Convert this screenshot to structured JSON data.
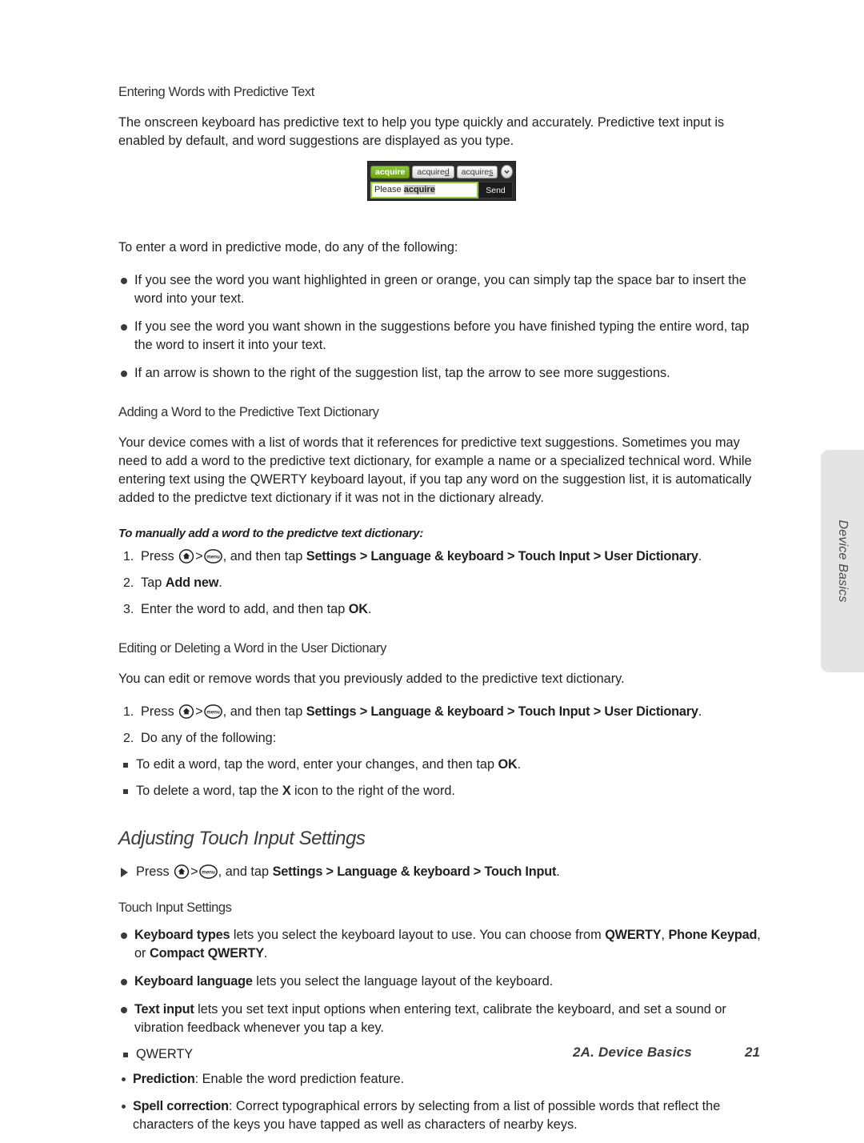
{
  "page": {
    "side_tab_label": "Device Basics",
    "footer_title": "2A. Device Basics",
    "footer_page": "21"
  },
  "colors": {
    "accent_green": "#8cc63f",
    "chip_active_green": "#6ca31a",
    "side_tab_gray": "#e4e4e4",
    "text": "#231f20"
  },
  "sections": {
    "predictive_text": {
      "heading": "Entering Words with Predictive Text",
      "intro": "The onscreen keyboard has predictive text to help you type quickly and accurately. Predictive text input is enabled by default, and word suggestions are displayed as you type.",
      "lead_in": "To enter a word in predictive mode, do any of the following:",
      "bullets": [
        "If you see the word you want highlighted in green or orange, you can simply tap the space bar to insert the word into your text.",
        "If you see the word you want shown in the suggestions before you have finished typing the entire word, tap the word to insert it into your text.",
        "If an arrow is shown to the right of the suggestion list, tap the arrow to see more suggestions."
      ]
    },
    "figure": {
      "suggestions": [
        {
          "text": "acquire",
          "active": true,
          "underline_last": false
        },
        {
          "text": "acquire",
          "suffix": "d",
          "active": false,
          "underline_last": true
        },
        {
          "text": "acquire",
          "suffix": "s",
          "active": false,
          "underline_last": true
        }
      ],
      "arrow_icon": "chevron-down-icon",
      "input_prefix": "Please ",
      "input_highlight": "acquire",
      "send_label": "Send"
    },
    "adding_word": {
      "heading": "Adding a Word to the Predictive Text Dictionary",
      "body": "Your device comes with a list of words that it references for predictive text suggestions. Sometimes you may need to add a word to the predictive text dictionary, for example a name or a specialized technical word. While entering text using the QWERTY keyboard layout, if you tap any word on the suggestion list, it is automatically added to the predictve text dictionary if it was not in the dictionary already.",
      "procedure_title": "To manually add a word to the predictve text dictionary:",
      "steps": [
        {
          "pre": "Press ",
          "keys": [
            "home-key",
            "menu-key"
          ],
          "mid": ", and then tap ",
          "path": [
            "Settings",
            "Language & keyboard",
            "Touch Input",
            "User Dictionary"
          ],
          "post": "."
        },
        {
          "pre": "Tap ",
          "bold": "Add new",
          "post": "."
        },
        {
          "pre": "Enter the word to add, and then tap ",
          "bold": "OK",
          "post": "."
        }
      ]
    },
    "editing_word": {
      "heading": "Editing or Deleting a Word in the User Dictionary",
      "body": "You can edit or remove words that you previously added to the predictive text dictionary.",
      "steps": [
        {
          "pre": "Press ",
          "keys": [
            "home-key",
            "menu-key"
          ],
          "mid": ", and then tap ",
          "path": [
            "Settings",
            "Language & keyboard",
            "Touch Input",
            "User Dictionary"
          ],
          "post": "."
        },
        {
          "pre": "Do any of the following:"
        }
      ],
      "sub_bullets": [
        {
          "pre": "To edit a word, tap the word, enter your changes, and then tap ",
          "bold": "OK",
          "post": "."
        },
        {
          "pre": "To delete a word, tap the ",
          "bold": "X",
          "post": " icon to the right of the word."
        }
      ]
    },
    "touch_input": {
      "heading": "Adjusting Touch Input Settings",
      "press_item": {
        "pre": "Press ",
        "keys": [
          "home-key",
          "menu-key"
        ],
        "mid": ", and tap ",
        "path": [
          "Settings",
          "Language & keyboard",
          "Touch Input"
        ],
        "post": "."
      },
      "subheading": "Touch Input Settings",
      "bullets": [
        {
          "bold": "Keyboard types",
          "text": " lets you select the keyboard layout to use. You can choose from ",
          "bold2": "QWERTY",
          "text2": ", ",
          "bold3": "Phone Keypad",
          "text3": ", or ",
          "bold4": "Compact QWERTY",
          "text4": "."
        },
        {
          "bold": "Keyboard language",
          "text": " lets you select the language layout of the keyboard."
        },
        {
          "bold": "Text input",
          "text": " lets you set text input options when entering text, calibrate the keyboard, and set a sound or vibration feedback whenever you tap a key."
        }
      ],
      "qwerty_label": "QWERTY",
      "qwerty_options": [
        {
          "bold": "Prediction",
          "text": ": Enable the word prediction feature."
        },
        {
          "bold": "Spell correction",
          "text": ": Correct typographical errors by selecting from a list of possible words that reflect the characters of the keys you have tapped as well as characters of nearby keys."
        }
      ]
    }
  },
  "key_glyphs": {
    "home_label": "home-icon",
    "menu_label": "menu"
  }
}
